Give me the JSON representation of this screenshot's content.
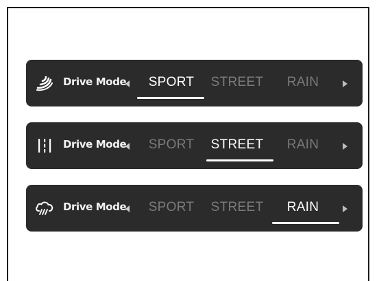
{
  "drive_mode_label": "Drive Mode",
  "modes": [
    "SPORT",
    "STREET",
    "RAIN"
  ],
  "selectors": [
    {
      "icon": "sport-wind-icon",
      "selected": "SPORT"
    },
    {
      "icon": "street-road-icon",
      "selected": "STREET"
    },
    {
      "icon": "rain-cloud-icon",
      "selected": "RAIN"
    }
  ],
  "colors": {
    "bar_background": "#2b2b2b",
    "active_text": "#ffffff",
    "inactive_text": "#7a7a7a",
    "frame_border": "#1c1c1c"
  }
}
